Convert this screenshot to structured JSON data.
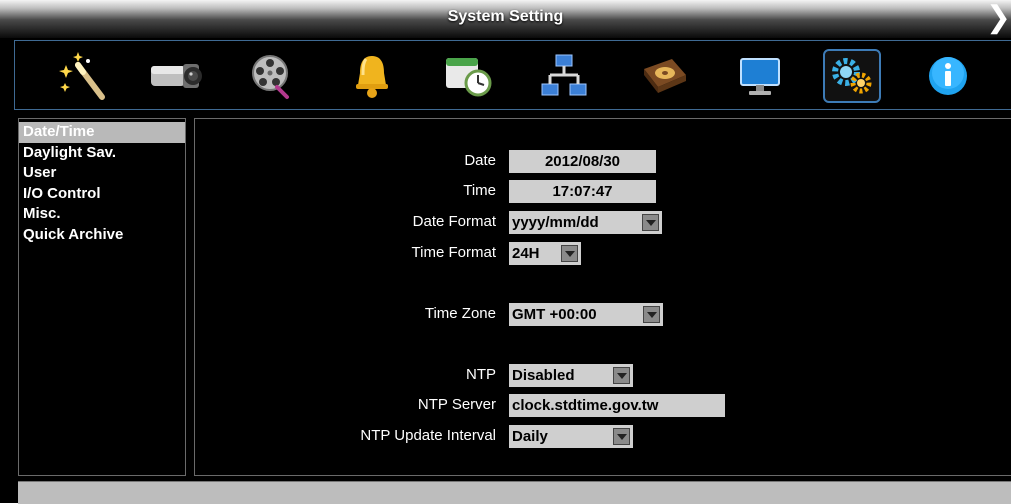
{
  "window": {
    "title": "System Setting",
    "close_symbol": "❯"
  },
  "toolbar": {
    "icons": [
      "wizard-wand-icon",
      "camera-icon",
      "film-reel-icon",
      "bell-icon",
      "schedule-clock-icon",
      "network-icon",
      "hard-disk-icon",
      "monitor-icon",
      "system-gears-icon",
      "info-icon"
    ],
    "active": "system-gears-icon"
  },
  "menu": {
    "items": [
      "Date/Time",
      "Daylight Sav.",
      "User",
      "I/O Control",
      "Misc.",
      "Quick Archive"
    ],
    "selected": "Date/Time"
  },
  "form": {
    "date": {
      "label": "Date",
      "value": "2012/08/30"
    },
    "time": {
      "label": "Time",
      "value": "17:07:47"
    },
    "date_format": {
      "label": "Date Format",
      "value": "yyyy/mm/dd"
    },
    "time_format": {
      "label": "Time Format",
      "value": "24H"
    },
    "time_zone": {
      "label": "Time Zone",
      "value": "GMT +00:00"
    },
    "ntp": {
      "label": "NTP",
      "value": "Disabled"
    },
    "ntp_server": {
      "label": "NTP Server",
      "value": "clock.stdtime.gov.tw"
    },
    "ntp_interval": {
      "label": "NTP Update Interval",
      "value": "Daily"
    }
  },
  "colors": {
    "accent_border": "#3f6a93",
    "selected_bg": "#b9b9b9",
    "field_bg": "#cfcfcf"
  }
}
